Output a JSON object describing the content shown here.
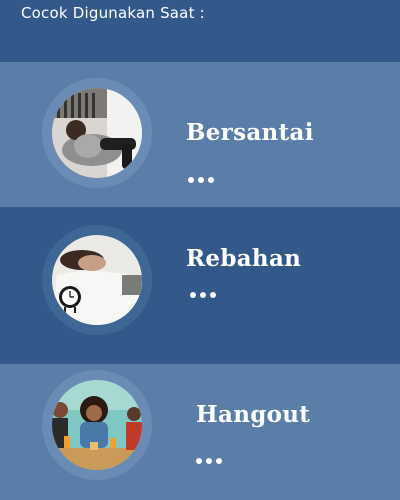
{
  "header": {
    "title": "Cocok Digunakan Saat :"
  },
  "activities": [
    {
      "label": "Bersantai",
      "image_icon": "person-relaxing-photo"
    },
    {
      "label": "Rebahan",
      "image_icon": "person-lying-bed-photo"
    },
    {
      "label": "Hangout",
      "image_icon": "friends-hangout-photo"
    }
  ],
  "colors": {
    "header_bg": "#33598a",
    "row_light": "#5a7ea8",
    "row_dark": "#33598a",
    "text": "#ffffff"
  }
}
